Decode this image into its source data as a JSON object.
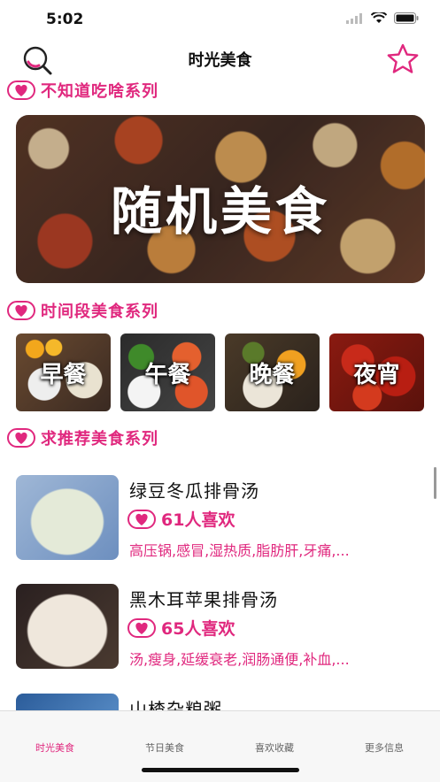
{
  "status_bar": {
    "time": "5:02"
  },
  "nav": {
    "title": "时光美食",
    "search_icon": "search-icon",
    "favorite_icon": "star-icon"
  },
  "sections": {
    "random": {
      "title": "不知道吃啥系列",
      "banner_text": "随机美食"
    },
    "time_slots": {
      "title": "时间段美食系列",
      "items": [
        {
          "label": "早餐"
        },
        {
          "label": "午餐"
        },
        {
          "label": "晚餐"
        },
        {
          "label": "夜宵"
        }
      ]
    },
    "recommend": {
      "title": "求推荐美食系列",
      "recipes": [
        {
          "name": "绿豆冬瓜排骨汤",
          "likes": "61人喜欢",
          "tags": "高压锅,感冒,湿热质,脂肪肝,牙痛,..."
        },
        {
          "name": "黑木耳苹果排骨汤",
          "likes": "65人喜欢",
          "tags": "汤,瘦身,延缓衰老,润肠通便,补血,..."
        },
        {
          "name": "山楂杂粮粥",
          "likes": "",
          "tags": ""
        }
      ]
    }
  },
  "tabbar": {
    "tabs": [
      {
        "label": "时光美食",
        "active": true
      },
      {
        "label": "节日美食",
        "active": false
      },
      {
        "label": "喜欢收藏",
        "active": false
      },
      {
        "label": "更多信息",
        "active": false
      }
    ]
  },
  "colors": {
    "accent": "#e0287e",
    "tab_bg": "#f7f7f7"
  }
}
